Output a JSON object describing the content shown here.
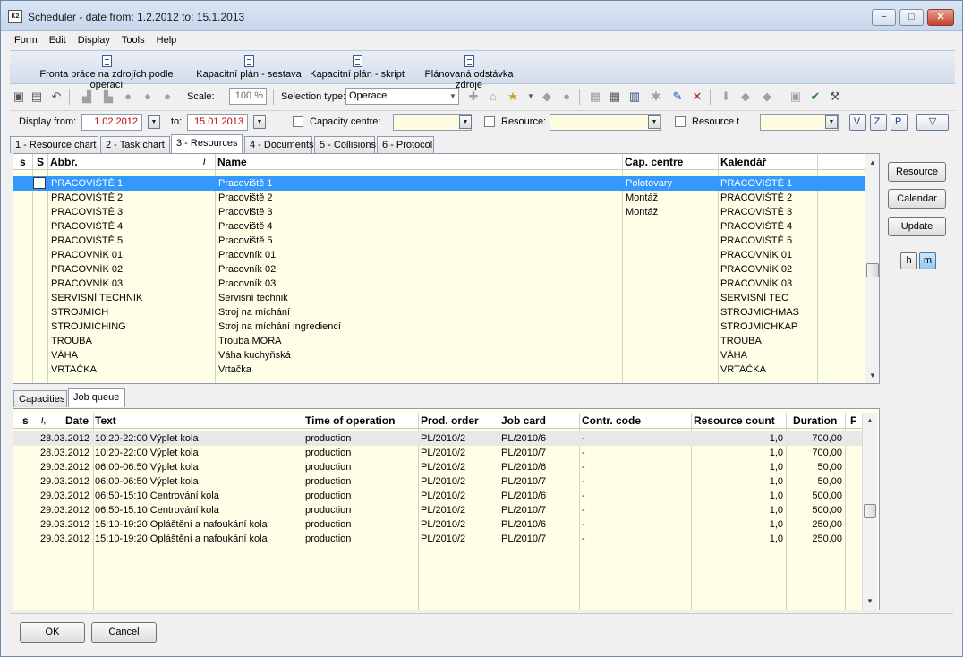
{
  "window": {
    "title": "Scheduler - date from: 1.2.2012 to: 15.1.2013",
    "app_icon": "K2",
    "minimize": "−",
    "maximize": "□",
    "close": "✕"
  },
  "menu": [
    "Form",
    "Edit",
    "Display",
    "Tools",
    "Help"
  ],
  "ribbon": [
    "Fronta práce na zdrojích podle operací",
    "Kapacitní plán - sestava",
    "Kapacitní plán - skript",
    "Plánovaná odstávka zdroje"
  ],
  "toolbar": {
    "scale_label": "Scale:",
    "scale_value": "100 %",
    "selection_type_label": "Selection type:",
    "selection_type_value": "Operace"
  },
  "filter": {
    "display_from_label": "Display from:",
    "display_from_value": "1.02.2012",
    "to_label": "to:",
    "to_value": "15.01.2013",
    "capacity_centre_label": "Capacity centre:",
    "resource_label": "Resource:",
    "resource_t_label": "Resource t",
    "v_btn": "V.",
    "z_btn": "Z.",
    "p_btn": "P.",
    "filter_icon": "▽"
  },
  "tabs": [
    "1 - Resource chart",
    "2 - Task chart",
    "3 - Resources",
    "4 - Documents",
    "5 - Collisions",
    "6 - Protocol"
  ],
  "resources": {
    "headers": {
      "s1": "s",
      "s2": "S",
      "abbr": "Abbr.",
      "sort_mark": "/",
      "name": "Name",
      "cap": "Cap. centre",
      "cal": "Kalendář"
    },
    "rows": [
      {
        "abbr": "PRACOVIŠTĚ 1",
        "name": "Pracoviště 1",
        "cap": "Polotovary",
        "cal": "PRACOVIŠTĚ 1"
      },
      {
        "abbr": "PRACOVIŠTĚ 2",
        "name": "Pracoviště 2",
        "cap": "Montáž",
        "cal": "PRACOVIŠTĚ 2"
      },
      {
        "abbr": "PRACOVIŠTĚ 3",
        "name": "Pracoviště 3",
        "cap": "Montáž",
        "cal": "PRACOVIŠTĚ 3"
      },
      {
        "abbr": "PRACOVIŠTĚ 4",
        "name": "Pracoviště 4",
        "cap": "",
        "cal": "PRACOVIŠTĚ 4"
      },
      {
        "abbr": "PRACOVIŠTĚ 5",
        "name": "Pracoviště 5",
        "cap": "",
        "cal": "PRACOVIŠTĚ 5"
      },
      {
        "abbr": "PRACOVNÍK 01",
        "name": "Pracovník 01",
        "cap": "",
        "cal": "PRACOVNÍK 01"
      },
      {
        "abbr": "PRACOVNÍK 02",
        "name": "Pracovník 02",
        "cap": "",
        "cal": "PRACOVNÍK 02"
      },
      {
        "abbr": "PRACOVNÍK 03",
        "name": "Pracovník 03",
        "cap": "",
        "cal": "PRACOVNÍK 03"
      },
      {
        "abbr": "SERVISNÍ TECHNIK",
        "name": "Servisní technik",
        "cap": "",
        "cal": "SERVISNÍ TEC"
      },
      {
        "abbr": "STROJMICH",
        "name": "Stroj na míchání",
        "cap": "",
        "cal": "STROJMICHMAS"
      },
      {
        "abbr": "STROJMICHING",
        "name": "Stroj na míchání ingrediencí",
        "cap": "",
        "cal": "STROJMICHKAP"
      },
      {
        "abbr": "TROUBA",
        "name": "Trouba MORA",
        "cap": "",
        "cal": "TROUBA"
      },
      {
        "abbr": "VÁHA",
        "name": "Váha kuchyňská",
        "cap": "",
        "cal": "VÁHA"
      },
      {
        "abbr": "VRTAČKA",
        "name": "Vrtačka",
        "cap": "",
        "cal": "VRTAČKA"
      }
    ]
  },
  "side_buttons": {
    "resource": "Resource",
    "calendar": "Calendar",
    "update": "Update",
    "h": "h",
    "m": "m"
  },
  "subtabs": [
    "Capacities",
    "Job queue"
  ],
  "jobs": {
    "headers": {
      "s": "s",
      "sort": "/,",
      "date": "Date",
      "text": "Text",
      "time_of_operation": "Time of operation",
      "prod_order": "Prod. order",
      "job_card": "Job card",
      "contr_code": "Contr. code",
      "resource_count": "Resource count",
      "duration": "Duration",
      "f": "F"
    },
    "rows": [
      {
        "date": "28.03.2012",
        "text": "10:20-22:00 Výplet kola",
        "time": "production",
        "order": "PL/2010/2",
        "card": "PL/2010/6",
        "code": "-",
        "count": "1,0",
        "duration": "700,00"
      },
      {
        "date": "28.03.2012",
        "text": "10:20-22:00 Výplet kola",
        "time": "production",
        "order": "PL/2010/2",
        "card": "PL/2010/7",
        "code": "-",
        "count": "1,0",
        "duration": "700,00"
      },
      {
        "date": "29.03.2012",
        "text": "06:00-06:50 Výplet kola",
        "time": "production",
        "order": "PL/2010/2",
        "card": "PL/2010/6",
        "code": "-",
        "count": "1,0",
        "duration": "50,00"
      },
      {
        "date": "29.03.2012",
        "text": "06:00-06:50 Výplet kola",
        "time": "production",
        "order": "PL/2010/2",
        "card": "PL/2010/7",
        "code": "-",
        "count": "1,0",
        "duration": "50,00"
      },
      {
        "date": "29.03.2012",
        "text": "06:50-15:10 Centrování kola",
        "time": "production",
        "order": "PL/2010/2",
        "card": "PL/2010/6",
        "code": "-",
        "count": "1,0",
        "duration": "500,00"
      },
      {
        "date": "29.03.2012",
        "text": "06:50-15:10 Centrování kola",
        "time": "production",
        "order": "PL/2010/2",
        "card": "PL/2010/7",
        "code": "-",
        "count": "1,0",
        "duration": "500,00"
      },
      {
        "date": "29.03.2012",
        "text": "15:10-19:20 Opláštění a nafoukání kola",
        "time": "production",
        "order": "PL/2010/2",
        "card": "PL/2010/6",
        "code": "-",
        "count": "1,0",
        "duration": "250,00"
      },
      {
        "date": "29.03.2012",
        "text": "15:10-19:20 Opláštění a nafoukání kola",
        "time": "production",
        "order": "PL/2010/2",
        "card": "PL/2010/7",
        "code": "-",
        "count": "1,0",
        "duration": "250,00"
      }
    ]
  },
  "bottom": {
    "ok": "OK",
    "cancel": "Cancel"
  }
}
